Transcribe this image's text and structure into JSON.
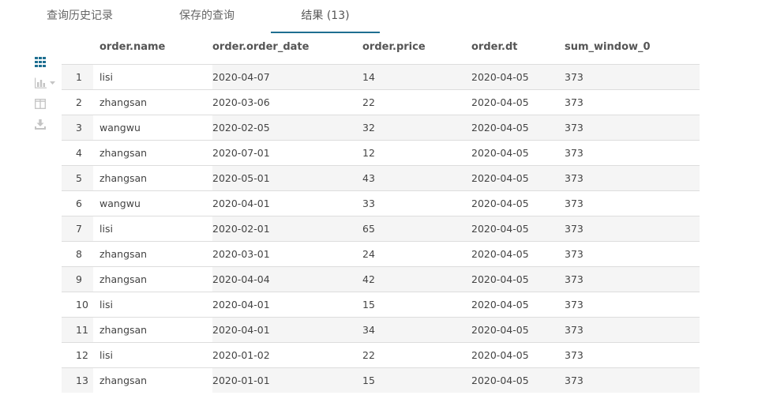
{
  "tabs": [
    {
      "label": "查询历史记录"
    },
    {
      "label": "保存的查询"
    },
    {
      "label": "结果 (13)"
    }
  ],
  "toolbar": {
    "icons": [
      "grid-view-icon",
      "chart-view-icon",
      "columns-icon",
      "download-icon"
    ],
    "colors": {
      "active": "#1f6f91",
      "inactive": "#c4c4c4"
    }
  },
  "table": {
    "columns": [
      "order.name",
      "order.order_date",
      "order.price",
      "order.dt",
      "sum_window_0"
    ],
    "rows": [
      {
        "idx": "1",
        "name": "lisi",
        "order_date": "2020-04-07",
        "price": "14",
        "dt": "2020-04-05",
        "sum": "373"
      },
      {
        "idx": "2",
        "name": "zhangsan",
        "order_date": "2020-03-06",
        "price": "22",
        "dt": "2020-04-05",
        "sum": "373"
      },
      {
        "idx": "3",
        "name": "wangwu",
        "order_date": "2020-02-05",
        "price": "32",
        "dt": "2020-04-05",
        "sum": "373"
      },
      {
        "idx": "4",
        "name": "zhangsan",
        "order_date": "2020-07-01",
        "price": "12",
        "dt": "2020-04-05",
        "sum": "373"
      },
      {
        "idx": "5",
        "name": "zhangsan",
        "order_date": "2020-05-01",
        "price": "43",
        "dt": "2020-04-05",
        "sum": "373"
      },
      {
        "idx": "6",
        "name": "wangwu",
        "order_date": "2020-04-01",
        "price": "33",
        "dt": "2020-04-05",
        "sum": "373"
      },
      {
        "idx": "7",
        "name": "lisi",
        "order_date": "2020-02-01",
        "price": "65",
        "dt": "2020-04-05",
        "sum": "373"
      },
      {
        "idx": "8",
        "name": "zhangsan",
        "order_date": "2020-03-01",
        "price": "24",
        "dt": "2020-04-05",
        "sum": "373"
      },
      {
        "idx": "9",
        "name": "zhangsan",
        "order_date": "2020-04-04",
        "price": "42",
        "dt": "2020-04-05",
        "sum": "373"
      },
      {
        "idx": "10",
        "name": "lisi",
        "order_date": "2020-04-01",
        "price": "15",
        "dt": "2020-04-05",
        "sum": "373"
      },
      {
        "idx": "11",
        "name": "zhangsan",
        "order_date": "2020-04-01",
        "price": "34",
        "dt": "2020-04-05",
        "sum": "373"
      },
      {
        "idx": "12",
        "name": "lisi",
        "order_date": "2020-01-02",
        "price": "22",
        "dt": "2020-04-05",
        "sum": "373"
      },
      {
        "idx": "13",
        "name": "zhangsan",
        "order_date": "2020-01-01",
        "price": "15",
        "dt": "2020-04-05",
        "sum": "373"
      }
    ]
  }
}
